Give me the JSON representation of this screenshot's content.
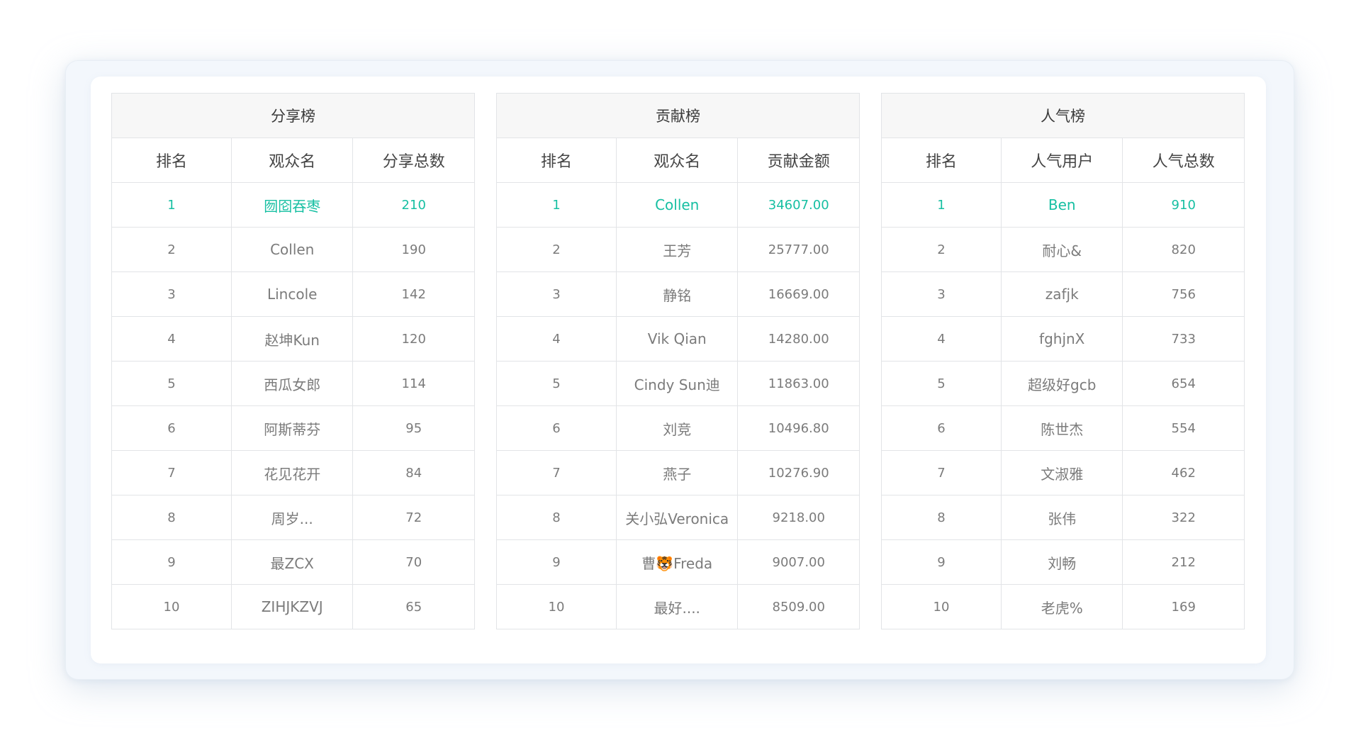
{
  "accent_color": "#16bfa2",
  "boards": [
    {
      "title": "分享榜",
      "columns": [
        "排名",
        "观众名",
        "分享总数"
      ],
      "rows": [
        [
          "1",
          "囫囵吞枣",
          "210"
        ],
        [
          "2",
          "Collen",
          "190"
        ],
        [
          "3",
          "Lincole",
          "142"
        ],
        [
          "4",
          "赵坤Kun",
          "120"
        ],
        [
          "5",
          "西瓜女郎",
          "114"
        ],
        [
          "6",
          "阿斯蒂芬",
          "95"
        ],
        [
          "7",
          "花见花开",
          "84"
        ],
        [
          "8",
          "周岁...",
          "72"
        ],
        [
          "9",
          "最ZCX",
          "70"
        ],
        [
          "10",
          "ZIHJKZVJ",
          "65"
        ]
      ]
    },
    {
      "title": "贡献榜",
      "columns": [
        "排名",
        "观众名",
        "贡献金额"
      ],
      "rows": [
        [
          "1",
          "Collen",
          "34607.00"
        ],
        [
          "2",
          "王芳",
          "25777.00"
        ],
        [
          "3",
          "静铭",
          "16669.00"
        ],
        [
          "4",
          "Vik Qian",
          "14280.00"
        ],
        [
          "5",
          "Cindy Sun迪",
          "11863.00"
        ],
        [
          "6",
          "刘竞",
          "10496.80"
        ],
        [
          "7",
          "燕子",
          "10276.90"
        ],
        [
          "8",
          "关小弘Veronica",
          "9218.00"
        ],
        [
          "9",
          "曹🐯Freda",
          "9007.00"
        ],
        [
          "10",
          "最好....",
          "8509.00"
        ]
      ]
    },
    {
      "title": "人气榜",
      "columns": [
        "排名",
        "人气用户",
        "人气总数"
      ],
      "rows": [
        [
          "1",
          "Ben",
          "910"
        ],
        [
          "2",
          "耐心&",
          "820"
        ],
        [
          "3",
          "zafjk",
          "756"
        ],
        [
          "4",
          "fghjnX",
          "733"
        ],
        [
          "5",
          "超级好gcb",
          "654"
        ],
        [
          "6",
          "陈世杰",
          "554"
        ],
        [
          "7",
          "文淑雅",
          "462"
        ],
        [
          "8",
          "张伟",
          "322"
        ],
        [
          "9",
          "刘畅",
          "212"
        ],
        [
          "10",
          "老虎%",
          "169"
        ]
      ]
    }
  ]
}
